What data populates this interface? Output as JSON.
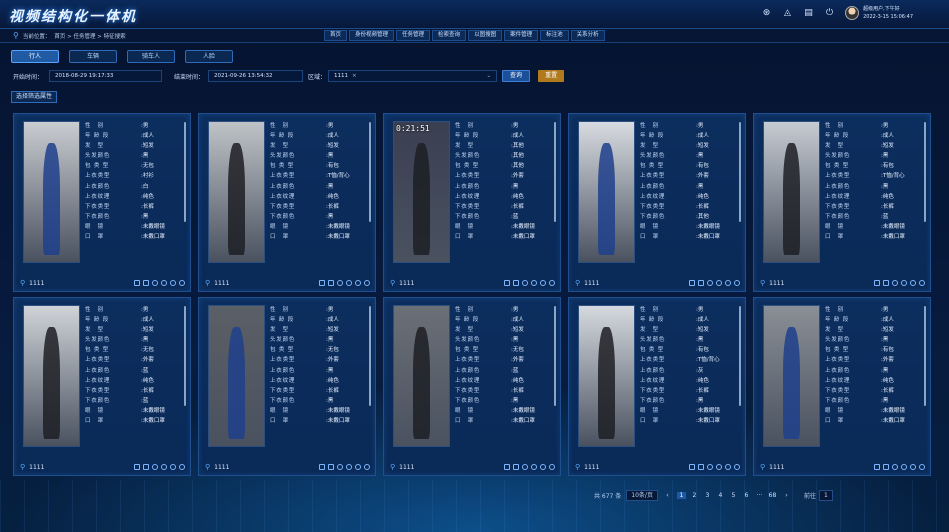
{
  "header": {
    "title": "视频结构化一体机",
    "user": {
      "name": "超级用户,下午好",
      "datetime": "2022-3-15 15:06:47"
    },
    "icons": [
      "settings-icon",
      "bell-icon",
      "document-icon",
      "power-icon"
    ]
  },
  "breadcrumb": {
    "label": "当前位置：",
    "path": "首页 > 任务管理 > 特征搜索"
  },
  "menu": [
    "首页",
    "身份视频管理",
    "任务管理",
    "检索查询",
    "以图搜图",
    "案件管理",
    "标注池",
    "关系分析"
  ],
  "tabs": [
    "行人",
    "车辆",
    "骑车人",
    "人脸"
  ],
  "filters": {
    "start_label": "开始时间：",
    "start": "2018-08-29 19:17:33",
    "end_label": "结束时间：",
    "end": "2021-09-26 13:54:32",
    "area_label": "区域：",
    "area_value": "1111",
    "area_tag": "×",
    "query": "查询",
    "reset": "重置"
  },
  "attr_select": "选择筛选属性",
  "attr_keys": [
    "性　别",
    "年 龄 段",
    "发　型",
    "头发颜色",
    "包 类 型",
    "上衣类型",
    "上衣颜色",
    "上衣纹理",
    "下衣类型",
    "下衣颜色",
    "眼　镜",
    "口　罩"
  ],
  "cards": [
    {
      "ts": "",
      "vals": [
        ":男",
        ":成人",
        ":短发",
        ":黑",
        ":无包",
        ":衬衫",
        ":白",
        ":纯色",
        ":长裤",
        ":黑",
        ":未戴眼镜",
        ":未戴口罩"
      ],
      "loc": "1111"
    },
    {
      "ts": "",
      "vals": [
        ":男",
        ":成人",
        ":短发",
        ":黑",
        ":有包",
        ":T恤/背心",
        ":黑",
        ":纯色",
        ":长裤",
        ":黑",
        ":未戴眼镜",
        ":未戴口罩"
      ],
      "loc": "1111"
    },
    {
      "ts": "0:21:51",
      "vals": [
        ":男",
        ":成人",
        ":其他",
        ":其他",
        ":其他",
        ":外套",
        ":黑",
        ":纯色",
        ":长裤",
        ":蓝",
        ":未戴眼镜",
        ":未戴口罩"
      ],
      "loc": "1111"
    },
    {
      "ts": "",
      "vals": [
        ":男",
        ":成人",
        ":短发",
        ":黑",
        ":有包",
        ":外套",
        ":黑",
        ":纯色",
        ":长裤",
        ":其他",
        ":未戴眼镜",
        ":未戴口罩"
      ],
      "loc": "1111"
    },
    {
      "ts": "",
      "vals": [
        ":男",
        ":成人",
        ":短发",
        ":黑",
        ":有包",
        ":T恤/背心",
        ":黑",
        ":纯色",
        ":长裤",
        ":蓝",
        ":未戴眼镜",
        ":未戴口罩"
      ],
      "loc": "1111"
    },
    {
      "ts": "",
      "vals": [
        ":男",
        ":成人",
        ":短发",
        ":黑",
        ":无包",
        ":外套",
        ":蓝",
        ":纯色",
        ":长裤",
        ":蓝",
        ":未戴眼镜",
        ":未戴口罩"
      ],
      "loc": "1111"
    },
    {
      "ts": "",
      "vals": [
        ":男",
        ":成人",
        ":短发",
        ":黑",
        ":无包",
        ":外套",
        ":黑",
        ":纯色",
        ":长裤",
        ":黑",
        ":未戴眼镜",
        ":未戴口罩"
      ],
      "loc": "1111"
    },
    {
      "ts": "",
      "vals": [
        ":男",
        ":成人",
        ":短发",
        ":黑",
        ":无包",
        ":外套",
        ":蓝",
        ":纯色",
        ":长裤",
        ":黑",
        ":未戴眼镜",
        ":未戴口罩"
      ],
      "loc": "1111"
    },
    {
      "ts": "",
      "vals": [
        ":男",
        ":成人",
        ":短发",
        ":黑",
        ":有包",
        ":T恤/背心",
        ":灰",
        ":纯色",
        ":长裤",
        ":黑",
        ":未戴眼镜",
        ":未戴口罩"
      ],
      "loc": "1111"
    },
    {
      "ts": "",
      "vals": [
        ":男",
        ":成人",
        ":短发",
        ":黑",
        ":有包",
        ":外套",
        ":黑",
        ":纯色",
        ":长裤",
        ":黑",
        ":未戴眼镜",
        ":未戴口罩"
      ],
      "loc": "1111"
    }
  ],
  "pager": {
    "total": "共 677 条",
    "size": "10条/页",
    "prev": "‹",
    "pages": [
      "1",
      "2",
      "3",
      "4",
      "5",
      "6",
      "···",
      "68"
    ],
    "next": "›",
    "jump_label": "前往",
    "jump_value": "1",
    "current": "1"
  },
  "colors": {
    "accent": "#1f5aa3",
    "reset": "#b07a1d",
    "bg": "#05132f"
  }
}
